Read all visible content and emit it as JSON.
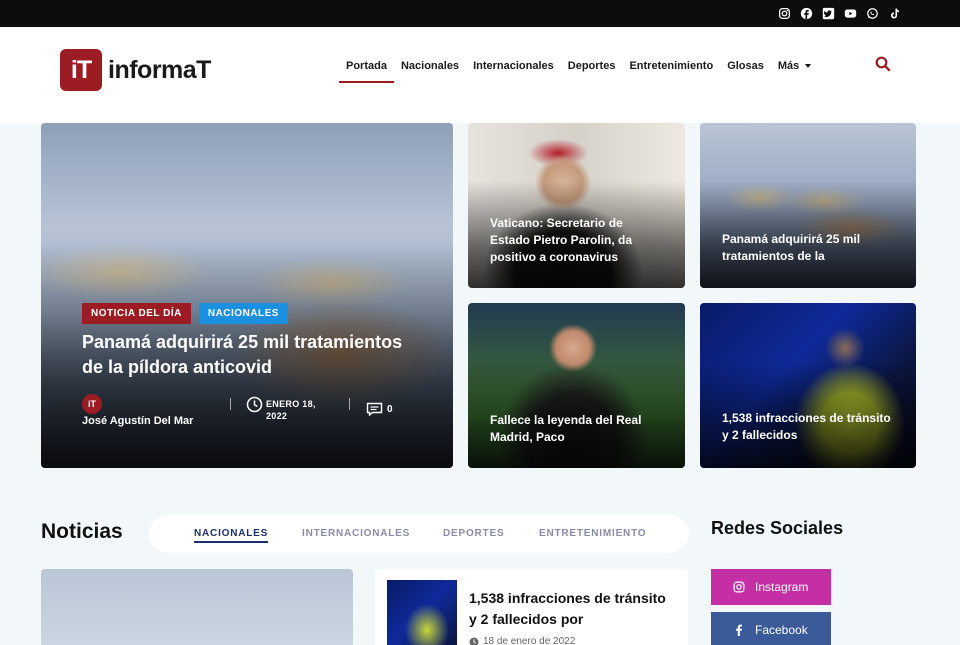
{
  "topbar": {
    "social_icons": [
      "instagram-icon",
      "facebook-icon",
      "twitter-icon",
      "youtube-icon",
      "whatsapp-icon",
      "tiktok-icon"
    ]
  },
  "header": {
    "logo_mark": "iT",
    "logo_text": "informaT",
    "nav": [
      {
        "label": "Portada",
        "active": true
      },
      {
        "label": "Nacionales"
      },
      {
        "label": "Internacionales"
      },
      {
        "label": "Deportes"
      },
      {
        "label": "Entretenimiento"
      },
      {
        "label": "Glosas"
      },
      {
        "label": "Más"
      }
    ]
  },
  "hero": {
    "badge_1": "NOTICIA DEL DÍA",
    "badge_2": "NACIONALES",
    "title": "Panamá adquirirá 25 mil tratamientos de la píldora anticovid",
    "author_avatar": "iT",
    "author": "José Agustín Del Mar",
    "date": "ENERO 18, 2022",
    "comments": "0"
  },
  "cards": [
    {
      "title": "Vaticano: Secretario de Estado Pietro Parolin, da positivo a coronavirus"
    },
    {
      "title": "Panamá adquirirá 25 mil tratamientos de la"
    },
    {
      "title": "Fallece la leyenda del Real Madrid, Paco"
    },
    {
      "title": "1,538 infracciones de tránsito y 2 fallecidos"
    }
  ],
  "noticias": {
    "title": "Noticias",
    "tabs": [
      "NACIONALES",
      "INTERNACIONALES",
      "DEPORTES",
      "ENTRETENIMIENTO"
    ],
    "item": {
      "title": "1,538 infracciones de tránsito y 2 fallecidos por",
      "date": "18 de enero de 2022"
    }
  },
  "sidebar": {
    "title": "Redes Sociales",
    "buttons": [
      "Instagram",
      "Facebook"
    ]
  },
  "colors": {
    "brand": "#9c1c24",
    "badge_blue": "#1b8fe0",
    "instagram": "#c42fa6",
    "facebook": "#3b5a9a"
  }
}
